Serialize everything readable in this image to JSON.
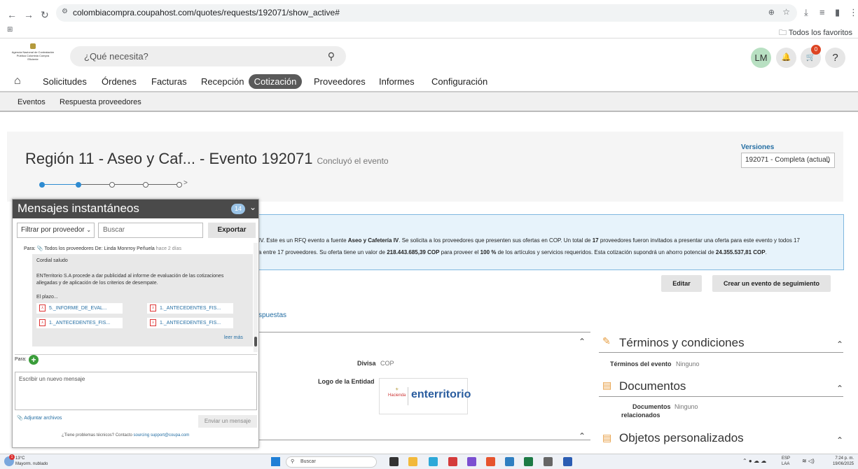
{
  "browser": {
    "url": "colombiacompra.coupahost.com/quotes/requests/192071/show_active#",
    "bookmarks_label": "Todos los favoritos"
  },
  "header": {
    "logo_text": "Agencia Nacional de Contratación Pública Colombia Compra Eficiente",
    "search_placeholder": "¿Qué necesita?",
    "avatar": "LM",
    "cart_count": "0",
    "help": "?"
  },
  "nav": {
    "items": [
      "Solicitudes",
      "Órdenes",
      "Facturas",
      "Recepción",
      "Cotización",
      "Proveedores",
      "Informes",
      "Configuración"
    ],
    "active": "Cotización"
  },
  "subnav": {
    "items": [
      "Eventos",
      "Respuesta proveedores"
    ]
  },
  "event": {
    "title": "Región 11 - Aseo y Caf... - Evento 192071",
    "status": "Concluyó el evento",
    "versions_label": "Versiones",
    "version_selected": "192071 - Completa (actual)"
  },
  "summary": {
    "line1_prefix": "IV. Este es un RFQ evento a fuente ",
    "line1_bold": "Aseo y Cafetería IV",
    "line1_mid": ". Se solicita a los proveedores que presenten sus ofertas en COP. Un total de ",
    "line1_count": "17",
    "line1_end": " proveedores fueron invitados a presentar una oferta para este evento y todos 17",
    "line2_prefix": "a entre 17 proveedores. Su oferta tiene un valor de ",
    "line2_value": "218.443.685,39 COP",
    "line2_mid": " para proveer el ",
    "line2_pct": "100 %",
    "line2_mid2": " de los artículos y servicios requeridos. Esta cotización supondrá un ahorro potencial de ",
    "line2_saving": "24.355.537,81 COP",
    "line2_end": "."
  },
  "actions": {
    "edit": "Editar",
    "follow_up": "Crear un evento de seguimiento"
  },
  "tab_partial": "spuestas",
  "fields": {
    "currency_label": "Divisa",
    "currency_value": "COP",
    "logo_label": "Logo de la Entidad",
    "logo_hacienda": "Hacienda",
    "logo_brand": "enterritorio"
  },
  "side_sections": {
    "terms_title": "Términos y condiciones",
    "terms_label": "Términos del evento",
    "terms_value": "Ninguno",
    "docs_title": "Documentos",
    "docs_label_1": "Documentos",
    "docs_label_2": "relacionados",
    "docs_value": "Ninguno",
    "custom_title": "Objetos personalizados"
  },
  "chat": {
    "title": "Mensajes instantáneos",
    "count": "14",
    "filter": "Filtrar por proveedor",
    "search": "Buscar",
    "export": "Exportar",
    "meta_to": "Para:",
    "meta_all": "Todos los proveedores De: Linda Monrroy Peñuela",
    "meta_time": "hace 2 días",
    "greeting": "Cordial saludo",
    "body_1": "ENTerritorio S.A procede a dar publicidad al informe de evaluación de las cotizaciones",
    "body_2": "allegadas y de aplicación de los criterios de desempate.",
    "deadline": "El plazo...",
    "attachments": [
      "5._INFORME_DE_EVAL...",
      "1._ANTECEDENTES_FIS...",
      "1._ANTECEDENTES_FIS...",
      "1._ANTECEDENTES_FIS..."
    ],
    "read_more": "leer más",
    "to_label": "Para:",
    "new_message_placeholder": "Escribir un nuevo mensaje",
    "attach": "Adjuntar archivos",
    "send": "Enviar un mensaje",
    "support_text": "¿Tiene problemas técnicos? Contacto",
    "support_link": "sourcing support@coupa.com"
  },
  "taskbar": {
    "temp": "13°C",
    "weather": "Mayorm. nublado",
    "weather_badge": "1",
    "search": "Buscar",
    "lang_1": "ESP",
    "lang_2": "LAA",
    "time": "7:24 p. m.",
    "date": "19/06/2025"
  }
}
